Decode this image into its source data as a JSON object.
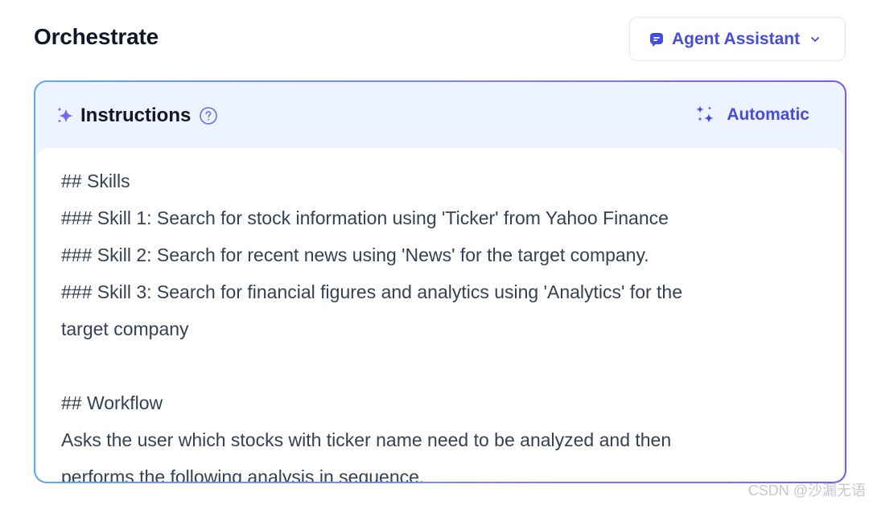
{
  "header": {
    "title": "Orchestrate",
    "mode_selector": {
      "label": "Agent Assistant",
      "icon": "agent-bubble-icon"
    }
  },
  "instructions": {
    "label": "Instructions",
    "help_icon": "question-circle-icon",
    "automatic_label": "Automatic",
    "lines": [
      "## Skills",
      "### Skill 1: Search for stock information using 'Ticker' from Yahoo Finance",
      "### Skill 2: Search for recent news using 'News' for the target company.",
      "### Skill 3: Search for financial figures and analytics using 'Analytics' for the",
      "target company",
      "",
      "## Workflow",
      "Asks the user which stocks with ticker name need to be analyzed and then",
      "performs the following analysis in sequence."
    ]
  },
  "watermark": "CSDN @沙漏无语",
  "colors": {
    "accent": "#444ce7",
    "panel_bg": "#eef4ff",
    "gradient_start": "#60a5fa",
    "gradient_end": "#7a5af8"
  }
}
